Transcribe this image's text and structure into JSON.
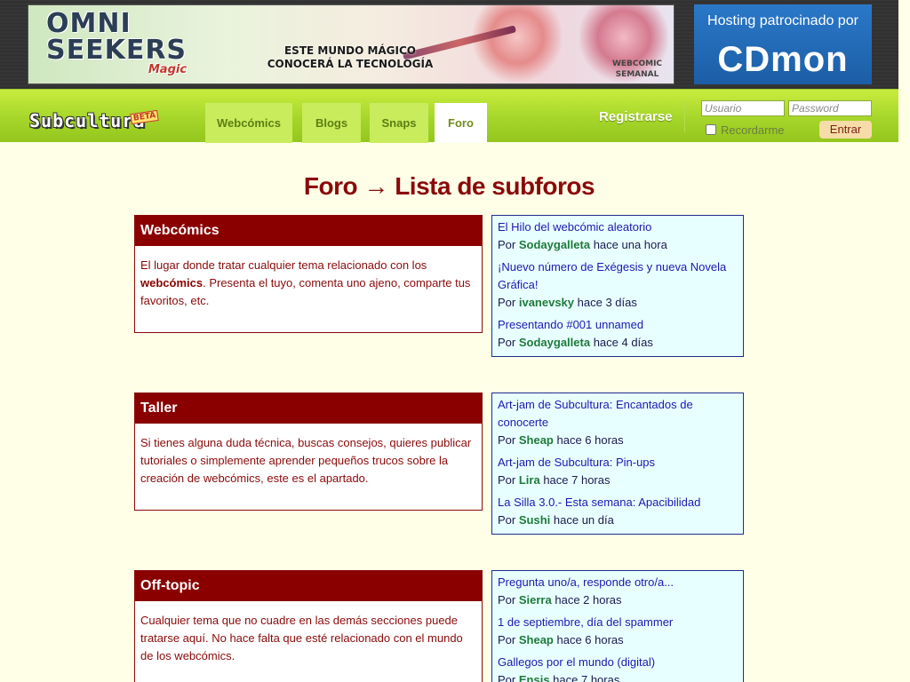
{
  "ad": {
    "brand_line1": "OMNI",
    "brand_line2": "SEEKERS",
    "brand_magic": "Magic",
    "tagline_line1": "ESTE MUNDO MÁGICO",
    "tagline_line2": "CONOCERÁ LA TECNOLOGÍA",
    "badge_line1": "WEBCOMIC",
    "badge_line2": "SEMANAL"
  },
  "hosting": {
    "text": "Hosting patrocinado por",
    "logo": "CDmon"
  },
  "nav": {
    "logo": "Subcultura",
    "beta": "BETA",
    "tabs": [
      {
        "label": "Webcómics",
        "active": false
      },
      {
        "label": "Blogs",
        "active": false
      },
      {
        "label": "Snaps",
        "active": false
      },
      {
        "label": "Foro",
        "active": true
      }
    ],
    "register": "Registrarse",
    "user_placeholder": "Usuario",
    "password_placeholder": "Password",
    "remember": "Recordarme",
    "login_button": "Entrar"
  },
  "page": {
    "title": "Foro → Lista de subforos"
  },
  "forums": [
    {
      "name": "Webcómics",
      "desc_before": "El lugar donde tratar cualquier tema relacionado con los ",
      "desc_bold": "webcómics",
      "desc_after": ". Presenta el tuyo, comenta uno ajeno, comparte tus favoritos, etc.",
      "posts": [
        {
          "title": "El Hilo del webcómic aleatorio",
          "by": "Por",
          "author": "Sodaygalleta",
          "when": "hace una hora"
        },
        {
          "title": "¡Nuevo número de Exégesis y nueva Novela Gráfica!",
          "by": "Por",
          "author": "ivanevsky",
          "when": "hace 3 días"
        },
        {
          "title": "Presentando #001 unnamed",
          "by": "Por",
          "author": "Sodaygalleta",
          "when": "hace 4 días"
        }
      ]
    },
    {
      "name": "Taller",
      "desc_before": "Si tienes alguna duda técnica, buscas consejos, quieres publicar tutoriales o simplemente aprender pequeños trucos sobre la creación de webcómics, este es el apartado.",
      "desc_bold": "",
      "desc_after": "",
      "posts": [
        {
          "title": "Art-jam de Subcultura: Encantados de conocerte",
          "by": "Por",
          "author": "Sheap",
          "when": "hace 6 horas"
        },
        {
          "title": "Art-jam de Subcultura: Pin-ups",
          "by": "Por",
          "author": "Lira",
          "when": "hace 7 horas"
        },
        {
          "title": "La Silla 3.0.- Esta semana: Apacibilidad",
          "by": "Por",
          "author": "Sushi",
          "when": "hace un día"
        }
      ]
    },
    {
      "name": "Off-topic",
      "desc_before": "Cualquier tema que no cuadre en las demás secciones puede tratarse aquí. No hace falta que esté relacionado con el mundo de los webcómics.",
      "desc_bold": "",
      "desc_after": "",
      "posts": [
        {
          "title": "Pregunta uno/a, responde otro/a...",
          "by": "Por",
          "author": "Sierra",
          "when": "hace 2 horas"
        },
        {
          "title": "1 de septiembre, día del spammer",
          "by": "Por",
          "author": "Sheap",
          "when": "hace 6 horas"
        },
        {
          "title": "Gallegos por el mundo (digital)",
          "by": "Por",
          "author": "Ensis",
          "when": "hace 7 horas"
        }
      ]
    }
  ]
}
